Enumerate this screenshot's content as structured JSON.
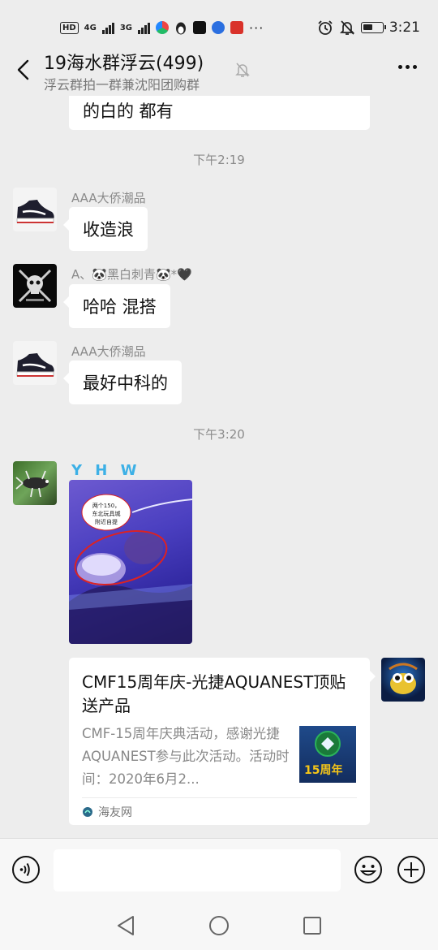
{
  "status_bar": {
    "hd_badge": "HD",
    "sim1_type": "4G",
    "sim2_type": "3G",
    "battery_percent": 60,
    "time": "3:21"
  },
  "header": {
    "title": "19海水群浮云(499)",
    "subtitle": "浮云群拍一群兼沈阳团购群",
    "icons": [
      "back-arrow-icon",
      "mute-bell-icon",
      "more-dots-icon"
    ]
  },
  "messages": {
    "partial_prev_text": "的白的 都有",
    "time_1": "下午2:19",
    "msg1": {
      "sender": "AAA大侨潮品",
      "text": "收造浪"
    },
    "msg2": {
      "sender": "A、🐼黑白刺青🐼*🖤",
      "text": "哈哈 混搭"
    },
    "msg3": {
      "sender": "AAA大侨潮品",
      "text": "最好中科的"
    },
    "time_2": "下午3:20",
    "msg4": {
      "sender": "Y H W",
      "photo_note": "两个150，东北玩具城附近自提"
    },
    "link_card": {
      "title": "CMF15周年庆-光捷AQUANEST顶贴送产品",
      "description": "CMF-15周年庆典活动，感谢光捷AQUANEST参与此次活动。活动时间：2020年6月2...",
      "thumb_text": "15周年",
      "source": "海友网"
    }
  },
  "input_bar": {
    "placeholder": "",
    "icons": [
      "voice-icon",
      "emoji-icon",
      "plus-icon"
    ]
  },
  "nav_bar": {
    "icons": [
      "nav-back-icon",
      "nav-home-icon",
      "nav-recent-icon"
    ]
  },
  "colors": {
    "background": "#ededed",
    "bubble": "#ffffff",
    "timestamp": "#8a8a8a",
    "sender_highlight": "#3cb0e6"
  }
}
